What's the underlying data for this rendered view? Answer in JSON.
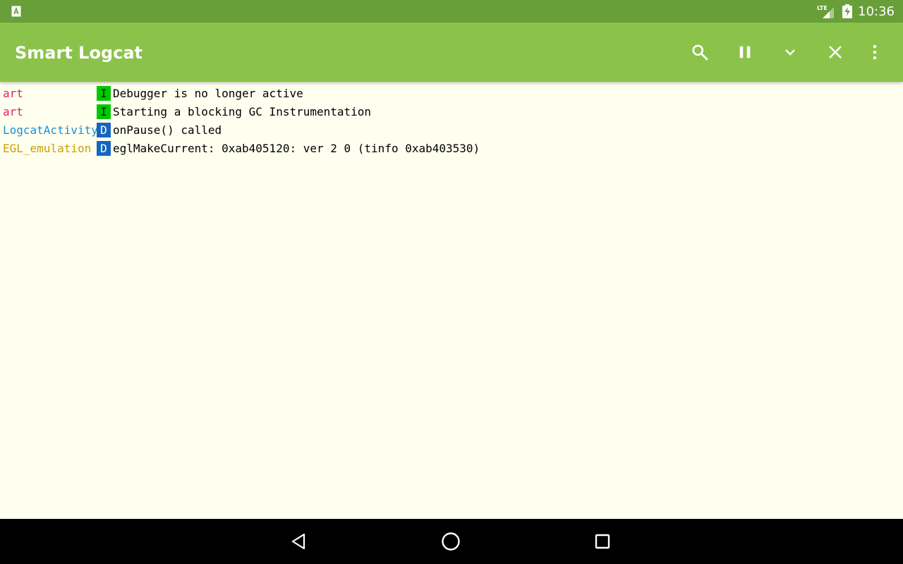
{
  "status_bar": {
    "time": "10:36",
    "network_label": "LTE",
    "notification_icon": "app-notification-icon",
    "signal_icon": "cell-signal-icon",
    "battery_icon": "battery-charging-icon",
    "background": "#689f38"
  },
  "app_bar": {
    "title": "Smart Logcat",
    "background": "#8bc34a",
    "actions": [
      {
        "name": "search",
        "icon": "search-icon"
      },
      {
        "name": "pause",
        "icon": "pause-icon"
      },
      {
        "name": "scroll-down",
        "icon": "chevron-down-icon"
      },
      {
        "name": "clear",
        "icon": "close-icon"
      },
      {
        "name": "overflow-menu",
        "icon": "more-vert-icon"
      }
    ]
  },
  "logs": [
    {
      "tag": "art",
      "tag_color": "#e0245e",
      "level": "I",
      "level_bg": "#00c800",
      "level_fg": "#1a1a1a",
      "message": "Debugger is no longer active"
    },
    {
      "tag": "art",
      "tag_color": "#e0245e",
      "level": "I",
      "level_bg": "#00c800",
      "level_fg": "#1a1a1a",
      "message": "Starting a blocking GC Instrumentation"
    },
    {
      "tag": "LogcatActivity",
      "tag_color": "#1e8fd6",
      "level": "D",
      "level_bg": "#1565c0",
      "level_fg": "#ffffff",
      "message": "onPause() called"
    },
    {
      "tag": "EGL_emulation",
      "tag_color": "#c9a000",
      "level": "D",
      "level_bg": "#1565c0",
      "level_fg": "#ffffff",
      "message": "eglMakeCurrent: 0xab405120: ver 2 0 (tinfo 0xab403530)"
    }
  ],
  "nav_bar": {
    "back_icon": "back-triangle-icon",
    "home_icon": "home-circle-icon",
    "recents_icon": "recents-square-icon"
  }
}
